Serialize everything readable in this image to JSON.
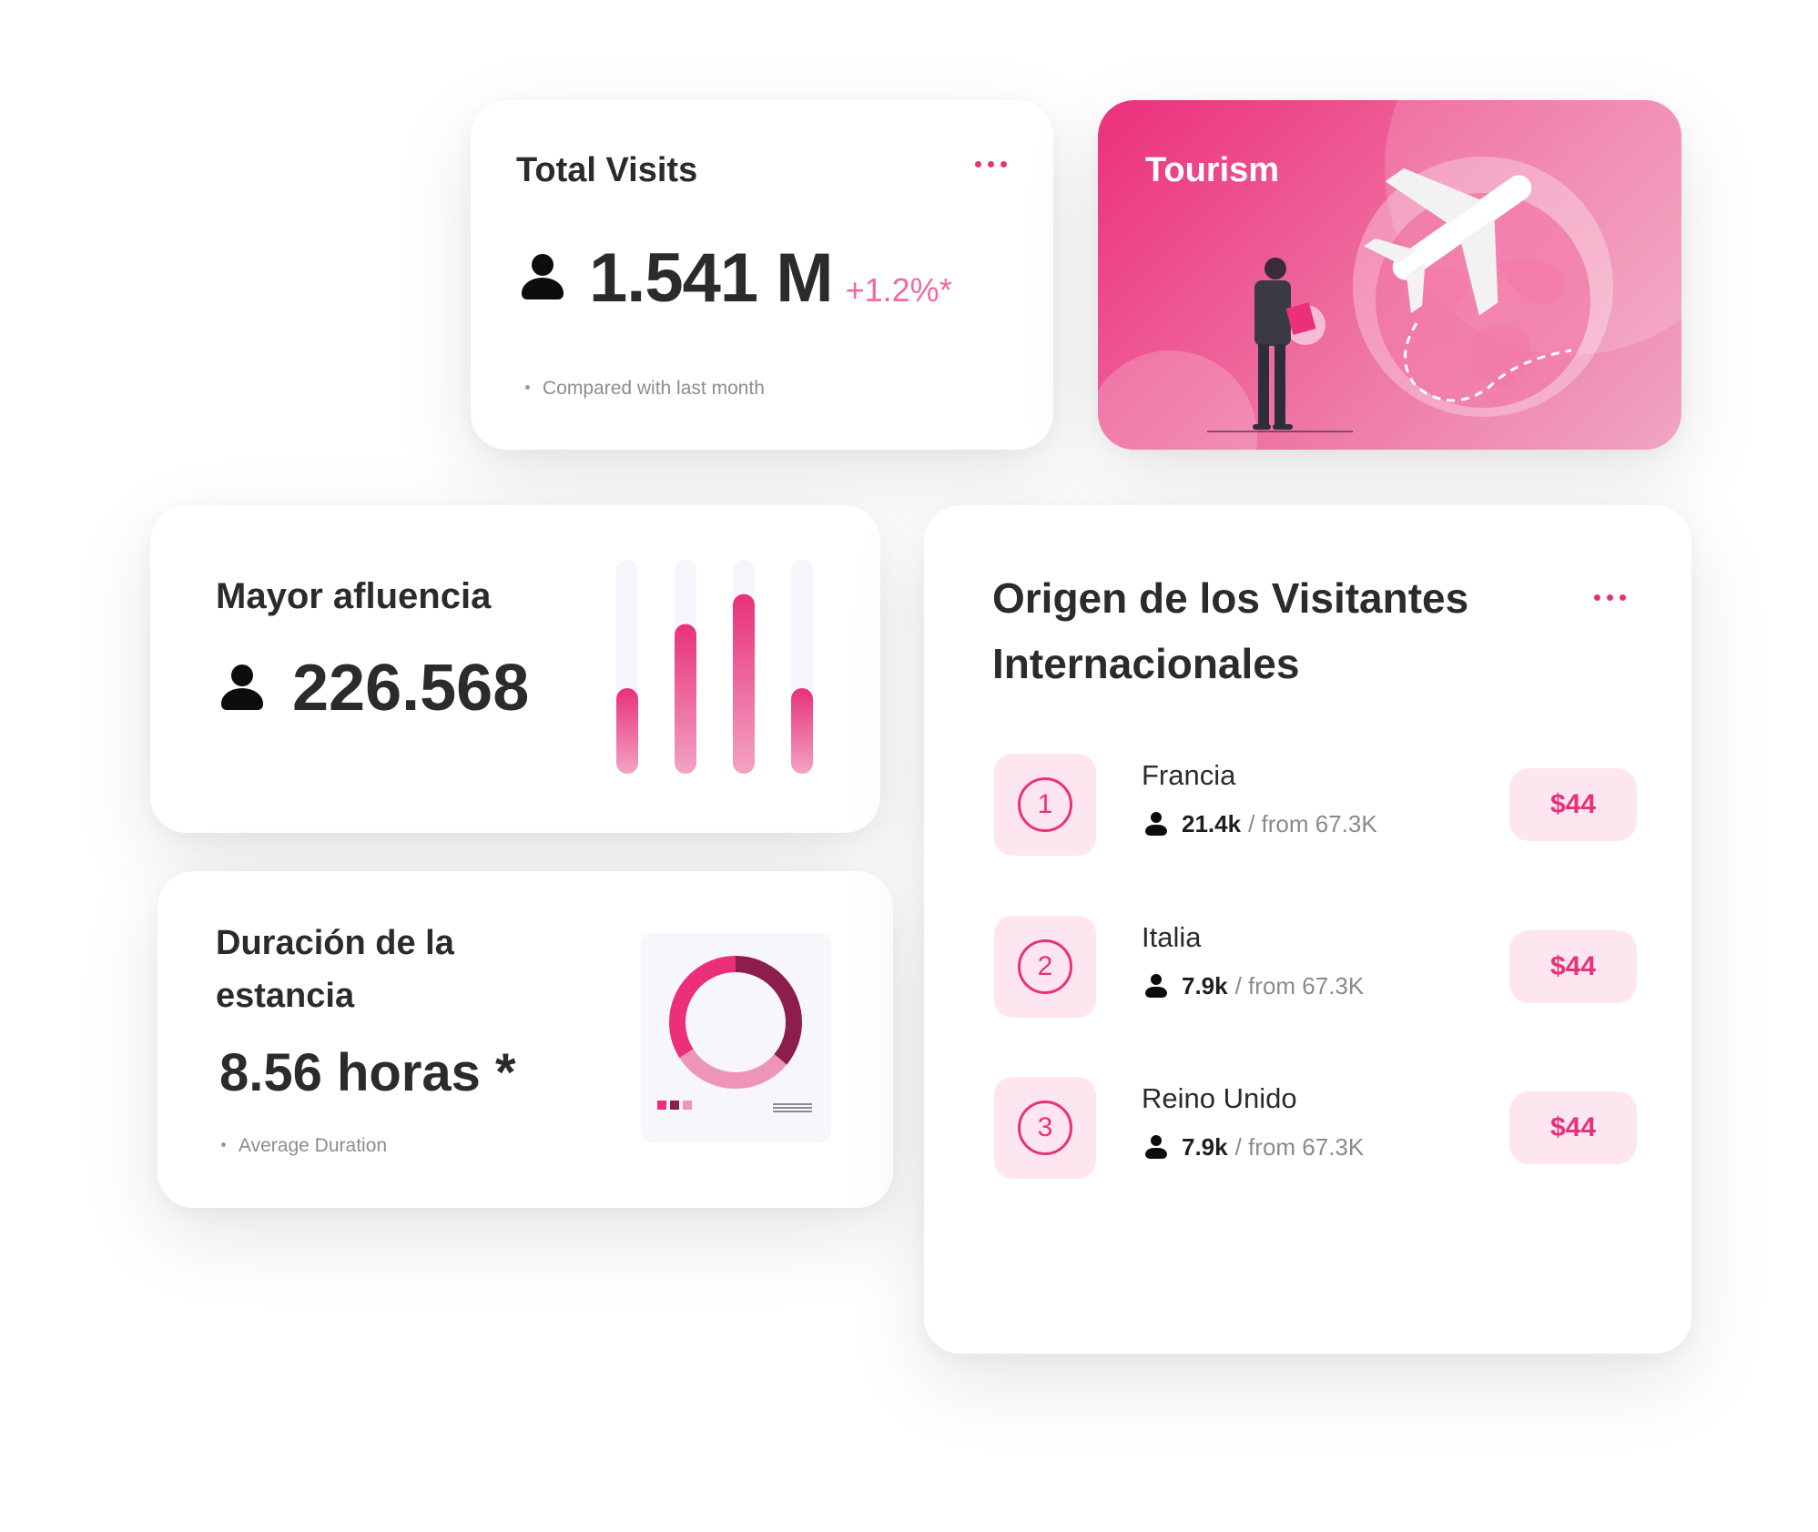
{
  "total_visits": {
    "title": "Total Visits",
    "value": "1.541 M",
    "change": "+1.2%*",
    "note": "Compared with last month",
    "icon": "person-icon"
  },
  "tourism": {
    "title": "Tourism",
    "illustration": "traveler-with-globe-and-airplane"
  },
  "peak": {
    "title": "Mayor afluencia",
    "value": "226.568",
    "bar_levels": [
      0.4,
      0.7,
      0.84,
      0.4
    ],
    "accent": "#e8317a"
  },
  "stay": {
    "title": "Duración de la estancia",
    "value": "8.56 horas *",
    "note": "Average Duration",
    "donut_segments": [
      {
        "share": 0.36,
        "color": "#8c1d4c"
      },
      {
        "share": 0.3,
        "color": "#ee94b9"
      },
      {
        "share": 0.34,
        "color": "#ec2f7b"
      }
    ]
  },
  "origin": {
    "title": "Origen de los Visitantes Internacionales",
    "rows": [
      {
        "rank": "1",
        "country": "Francia",
        "count": "21.4k",
        "from": "/ from 67.3K",
        "price": "$44"
      },
      {
        "rank": "2",
        "country": "Italia",
        "count": "7.9k",
        "from": "/ from 67.3K",
        "price": "$44"
      },
      {
        "rank": "3",
        "country": "Reino Unido",
        "count": "7.9k",
        "from": "/ from 67.3K",
        "price": "$44"
      }
    ]
  },
  "colors": {
    "accent": "#e8317a",
    "accent_light": "#fde6ef",
    "text": "#2b2b2b"
  }
}
